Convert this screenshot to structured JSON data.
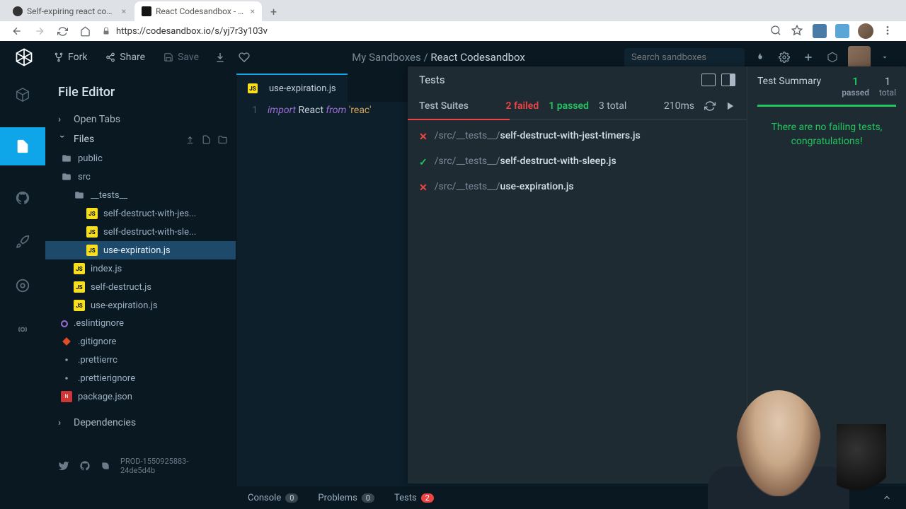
{
  "browser": {
    "tabs": [
      {
        "title": "Self-expiring react component",
        "active": false
      },
      {
        "title": "React Codesandbox - CodeSa",
        "active": true
      }
    ],
    "url": "https://codesandbox.io/s/yj7r3y103v"
  },
  "header": {
    "fork": "Fork",
    "share": "Share",
    "save": "Save",
    "breadcrumb_prefix": "My Sandboxes / ",
    "breadcrumb_current": "React Codesandbox",
    "search_placeholder": "Search sandboxes"
  },
  "sidebar": {
    "title": "File Editor",
    "open_tabs": "Open Tabs",
    "files": "Files",
    "dependencies": "Dependencies",
    "version": "PROD-1550925883-24de5d4b",
    "tree": {
      "public": "public",
      "src": "src",
      "tests": "__tests__",
      "f1": "self-destruct-with-jes...",
      "f2": "self-destruct-with-sle...",
      "f3": "use-expiration.js",
      "index": "index.js",
      "selfdestruct": "self-destruct.js",
      "useexp": "use-expiration.js",
      "eslintignore": ".eslintignore",
      "gitignore": ".gitignore",
      "prettierrc": ".prettierrc",
      "prettierignore": ".prettierignore",
      "package": "package.json"
    }
  },
  "editor": {
    "active_tab": "use-expiration.js",
    "line_no": "1",
    "code_kw1": "import",
    "code_ident": " React ",
    "code_kw2": "from",
    "code_str": " 'reac'"
  },
  "tests": {
    "title": "Tests",
    "suites_label": "Test Suites",
    "failed": "2 failed",
    "passed": "1 passed",
    "total": "3 total",
    "time": "210ms",
    "suites": [
      {
        "status": "bad",
        "dir": "/src/__tests__/",
        "file": "self-destruct-with-jest-timers.js"
      },
      {
        "status": "ok",
        "dir": "/src/__tests__/",
        "file": "self-destruct-with-sleep.js"
      },
      {
        "status": "bad",
        "dir": "/src/__tests__/",
        "file": "use-expiration.js"
      }
    ],
    "summary": {
      "title": "Test Summary",
      "passed_n": "1",
      "passed_t": "passed",
      "total_n": "1",
      "total_t": "total",
      "msg": "There are no failing tests, congratulations!"
    }
  },
  "console": {
    "console": "Console",
    "console_n": "0",
    "problems": "Problems",
    "problems_n": "0",
    "tests": "Tests",
    "tests_n": "2"
  }
}
